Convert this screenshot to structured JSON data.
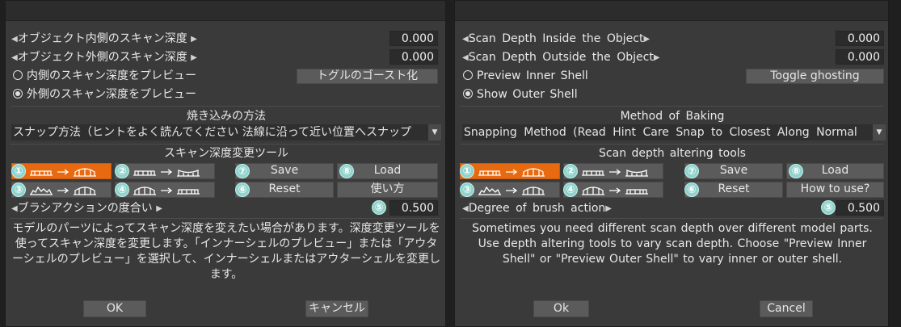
{
  "jp": {
    "scan_inside_label": "オブジェクト内側のスキャン深度",
    "scan_inside_value": "0.000",
    "scan_outside_label": "オブジェクト外側のスキャン深度",
    "scan_outside_value": "0.000",
    "preview_inner_label": "内側のスキャン深度をプレビュー",
    "preview_outer_label": "外側のスキャン深度をプレビュー",
    "toggle_ghosting": "トグルのゴースト化",
    "baking_heading": "焼き込みの方法",
    "snapping_value": "スナップ方法（ヒントをよく読んでください 法線に沿って近い位置へスナップ",
    "tools_heading": "スキャン深度変更ツール",
    "save": "Save",
    "load": "Load",
    "reset": "Reset",
    "how_to": "使い方",
    "brush_label": "ブラシアクションの度合い",
    "brush_value": "0.500",
    "description": "モデルのパーツによってスキャン深度を変えたい場合があります。深度変更ツールを使ってスキャン深度を変更します。「インナーシェルのプレビュー」または「アウターシェルのプレビュー」を選択して、インナーシェルまたはアウターシェルを変更します。",
    "ok": "OK",
    "cancel": "キャンセル"
  },
  "en": {
    "scan_inside_label": "Scan Depth Inside the Object",
    "scan_inside_value": "0.000",
    "scan_outside_label": "Scan Depth Outside the Object",
    "scan_outside_value": "0.000",
    "preview_inner_label": "Preview Inner Shell",
    "preview_outer_label": "Show Outer Shell",
    "toggle_ghosting": "Toggle ghosting",
    "baking_heading": "Method of Baking",
    "snapping_value": "Snapping Method (Read Hint Care Snap to Closest Along Normal",
    "tools_heading": "Scan depth altering tools",
    "save": "Save",
    "load": "Load",
    "reset": "Reset",
    "how_to": "How to use?",
    "brush_label": "Degree of brush action",
    "brush_value": "0.500",
    "description": "Sometimes you need different scan depth over different model parts. Use depth altering tools to vary scan depth. Choose \"Preview Inner Shell\" or \"Preview Outer Shell\" to vary inner or outer shell.",
    "ok": "Ok",
    "cancel": "Cancel"
  },
  "badges": [
    "①",
    "②",
    "③",
    "④",
    "⑤",
    "⑥",
    "⑦",
    "⑧"
  ],
  "selected_radio": "outer",
  "active_tool": 1,
  "colors": {
    "accent": "#e86a10",
    "badge": "#8fd3cc",
    "panel": "#3a3a3a"
  }
}
